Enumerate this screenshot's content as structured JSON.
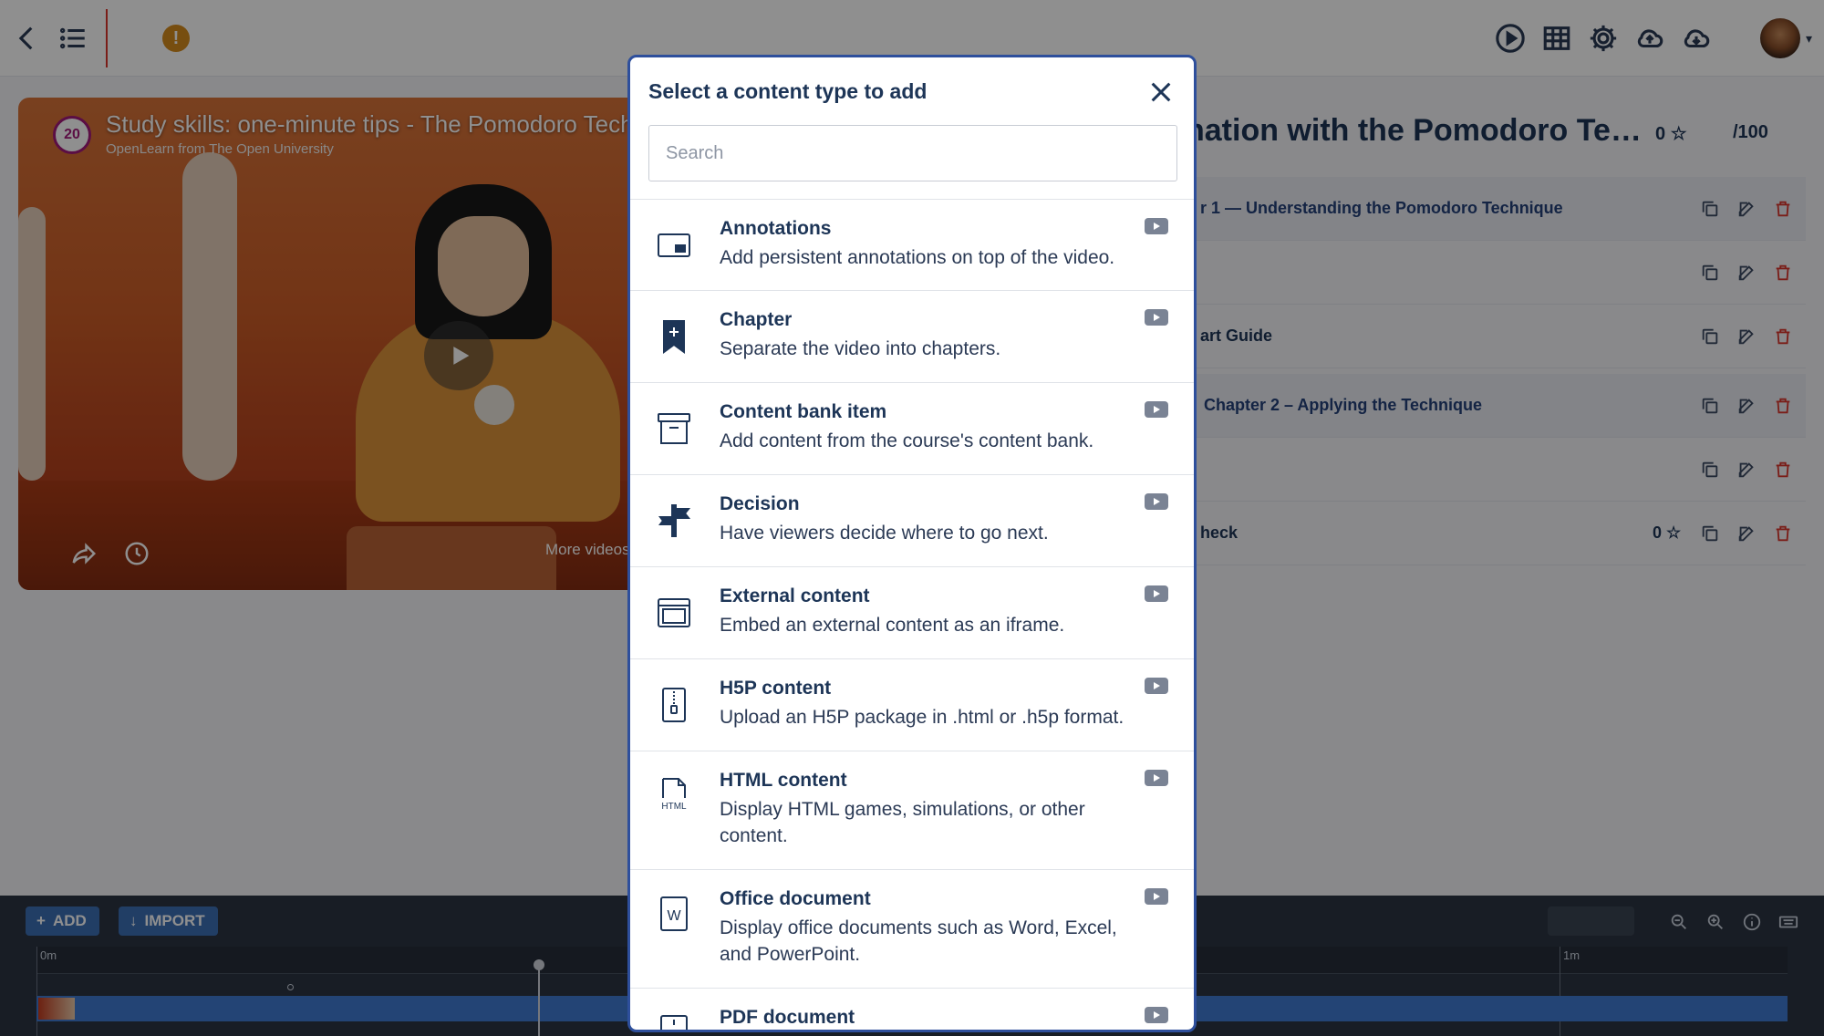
{
  "topbar": {
    "back_icon": "chevron-left-icon",
    "list_icon": "list-icon",
    "warning_badge": "!",
    "action_icons": [
      "play-circle-icon",
      "table-icon",
      "gear-icon",
      "cloud-upload-icon",
      "cloud-download-icon"
    ]
  },
  "video": {
    "channel_badge": "20",
    "title": "Study skills: one-minute tips - The Pomodoro Techn",
    "subtitle": "OpenLearn from The Open University",
    "more_videos": "More videos"
  },
  "right_panel": {
    "title": "nation with the Pomodoro Te…",
    "score": "0",
    "max": "/100",
    "rows": [
      {
        "label": "r 1 — Understanding the Pomodoro Technique",
        "type": "chapter",
        "score": ""
      },
      {
        "label": "",
        "type": "item",
        "score": ""
      },
      {
        "label": "art Guide",
        "type": "item",
        "score": ""
      },
      {
        "label": "Chapter 2 – Applying the Technique",
        "type": "chapter",
        "score": ""
      },
      {
        "label": "",
        "type": "item",
        "score": ""
      },
      {
        "label": "heck",
        "type": "item",
        "score": "0"
      }
    ]
  },
  "timeline": {
    "add_label": "ADD",
    "import_label": "IMPORT",
    "mark_start": "0m",
    "mark_end": "1m"
  },
  "modal": {
    "title": "Select a content type to add",
    "search_placeholder": "Search",
    "search_value": "",
    "items": [
      {
        "name": "Annotations",
        "desc": "Add persistent annotations on top of the video.",
        "icon": "annotation-icon"
      },
      {
        "name": "Chapter",
        "desc": "Separate the video into chapters.",
        "icon": "bookmark-plus-icon"
      },
      {
        "name": "Content bank item",
        "desc": "Add content from the course's content bank.",
        "icon": "archive-box-icon"
      },
      {
        "name": "Decision",
        "desc": "Have viewers decide where to go next.",
        "icon": "signpost-icon"
      },
      {
        "name": "External content",
        "desc": "Embed an external content as an iframe.",
        "icon": "browser-window-icon"
      },
      {
        "name": "H5P content",
        "desc": "Upload an H5P package in .html or .h5p format.",
        "icon": "zip-file-icon"
      },
      {
        "name": "HTML content",
        "desc": "Display HTML games, simulations, or other content.",
        "icon": "html-file-icon",
        "icon_text": "HTML"
      },
      {
        "name": "Office document",
        "desc": "Display office documents such as Word, Excel, and PowerPoint.",
        "icon": "word-file-icon",
        "icon_text": "W"
      },
      {
        "name": "PDF document",
        "desc": "",
        "icon": "pdf-file-icon"
      }
    ]
  }
}
